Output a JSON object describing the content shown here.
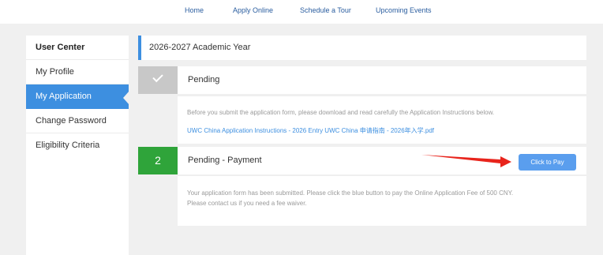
{
  "nav": {
    "home": "Home",
    "apply_online": "Apply Online",
    "schedule_tour": "Schedule a Tour",
    "upcoming_events": "Upcoming Events"
  },
  "sidebar": {
    "header": "User Center",
    "items": [
      {
        "label": "My Profile",
        "active": false
      },
      {
        "label": "My Application",
        "active": true
      },
      {
        "label": "Change Password",
        "active": false
      },
      {
        "label": "Eligibility Criteria",
        "active": false
      }
    ]
  },
  "main": {
    "academic_year": "2026-2027 Academic Year",
    "steps": [
      {
        "number_icon": "checkmark-icon",
        "title": "Pending",
        "description": "Before you submit the application form, please download and read carefully the Application Instructions below.",
        "link": "UWC China Application Instructions - 2026 Entry UWC China 申请指南 - 2026年入学.pdf"
      },
      {
        "number": "2",
        "title": "Pending - Payment",
        "button_label": "Click to Pay",
        "description_line1": "Your application form has been submitted. Please click the blue button to pay the Online Application Fee of 500 CNY.",
        "description_line2": "Please contact us if you need a fee waiver."
      }
    ]
  },
  "colors": {
    "accent_blue": "#3d8fe0",
    "step_done_gray": "#c8c8c8",
    "step_active_green": "#2fa43a",
    "button_blue": "#5a9eee",
    "annotation_arrow_red": "#e8241c"
  }
}
